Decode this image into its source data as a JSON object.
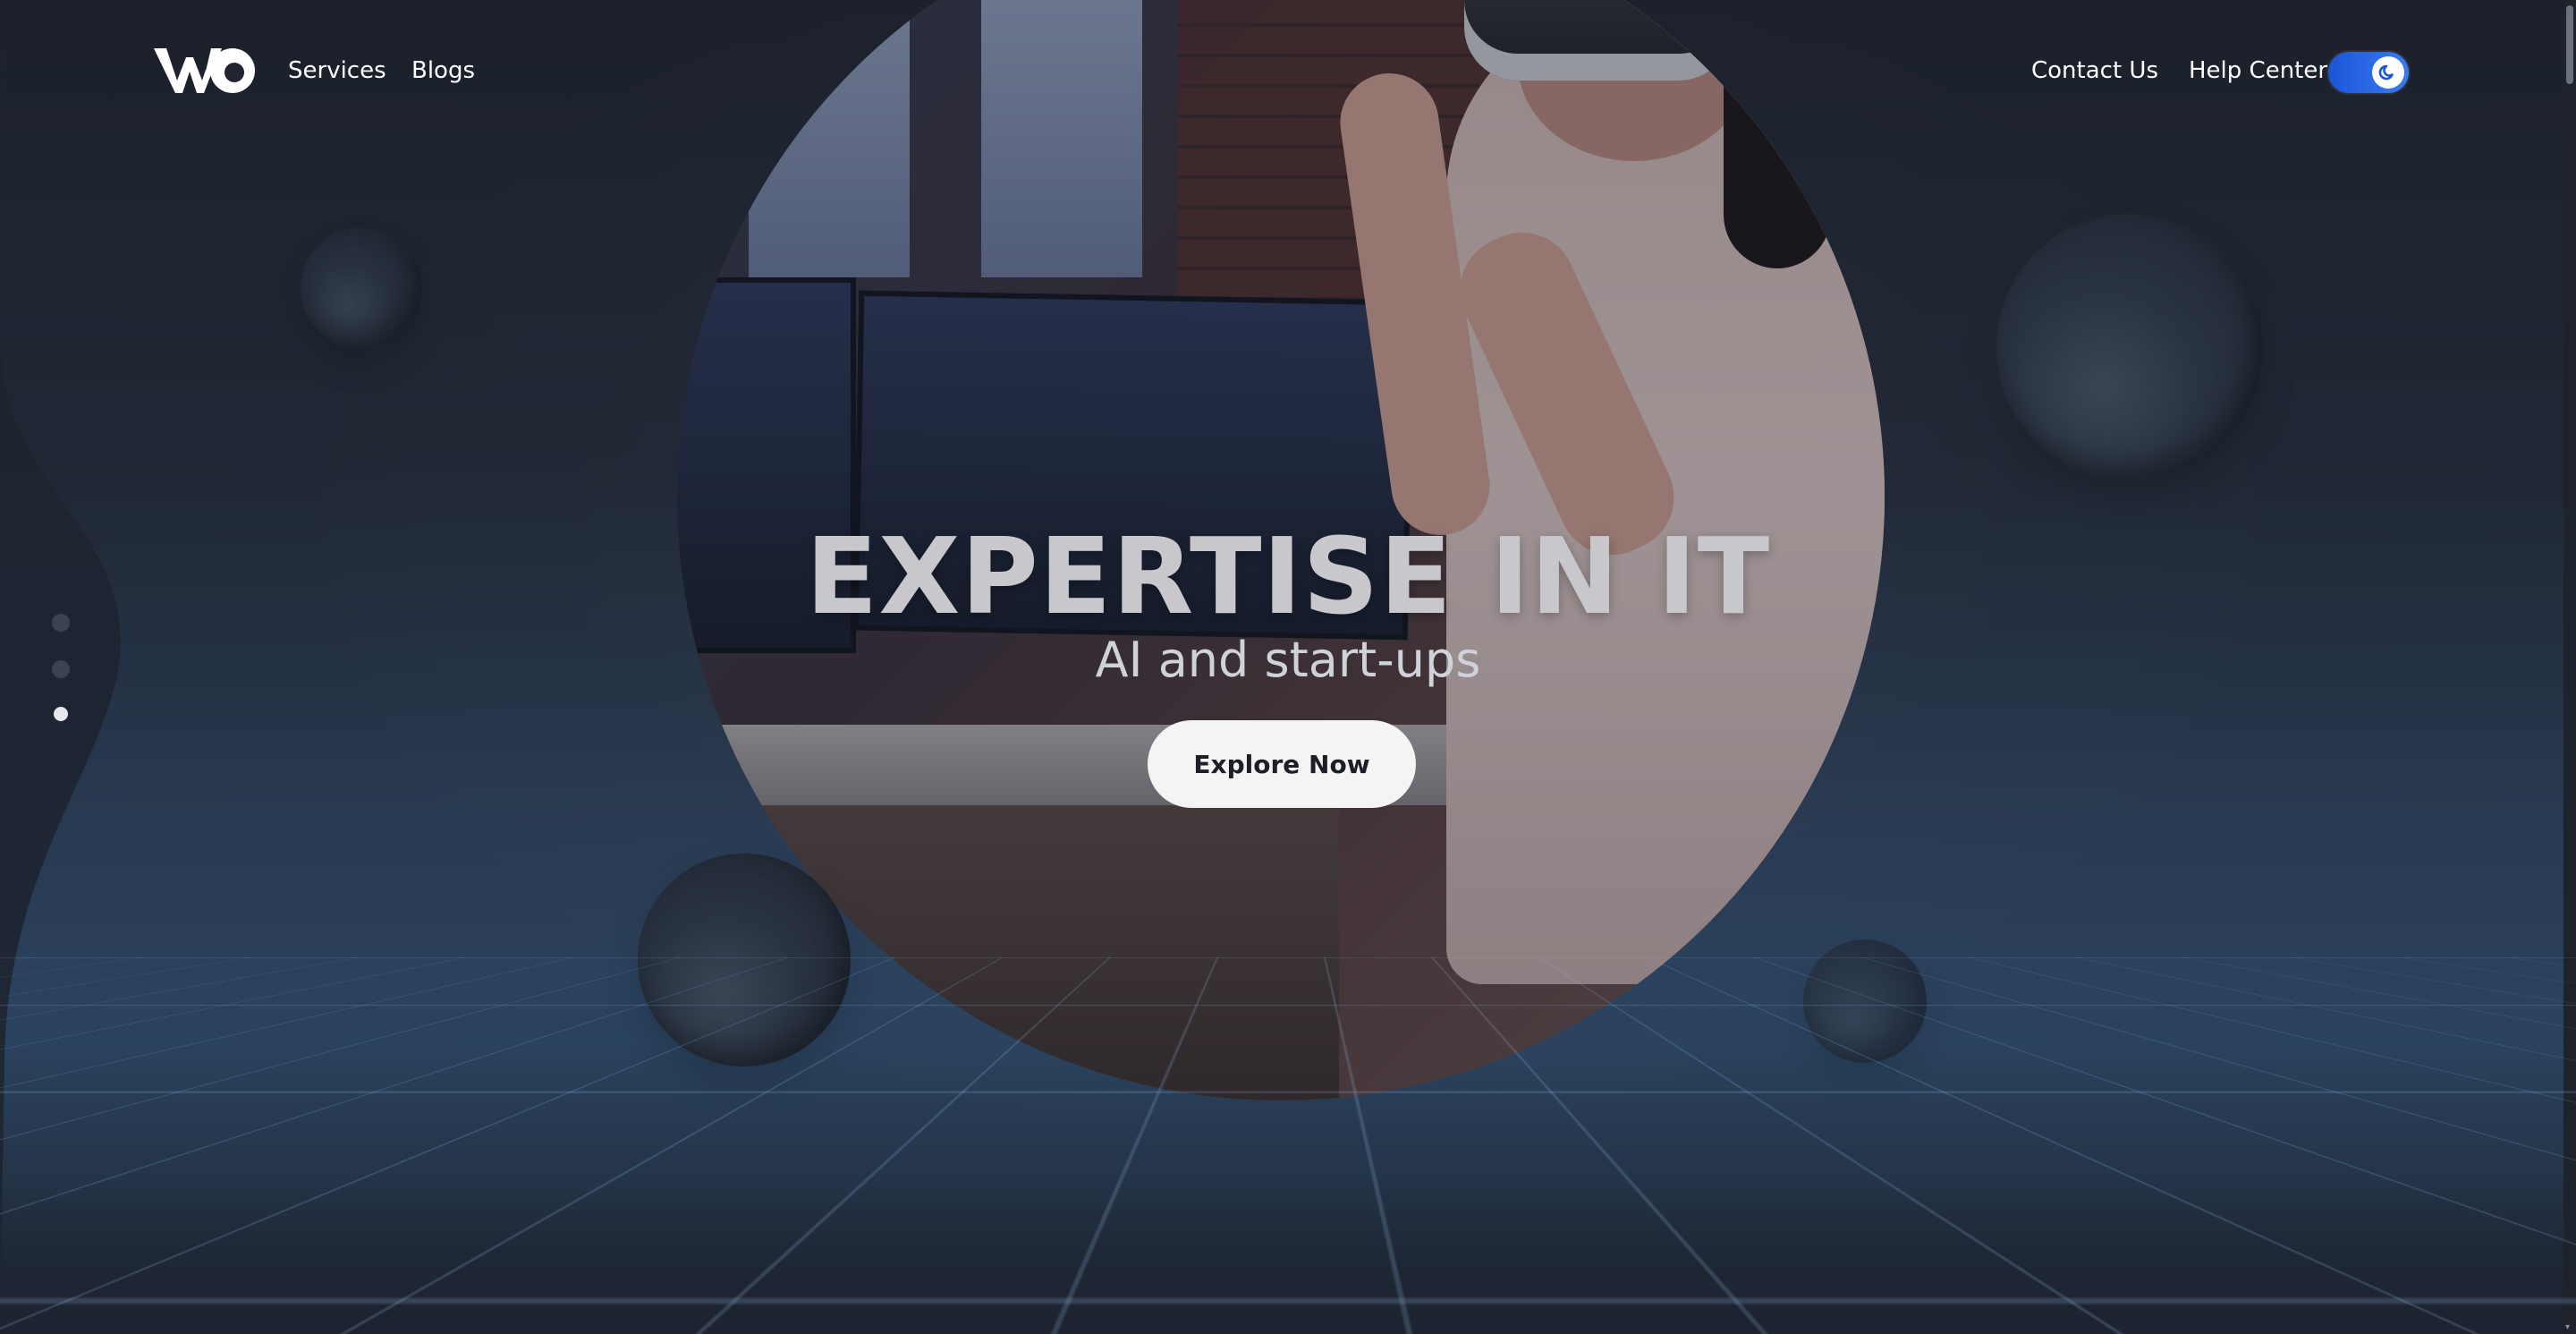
{
  "nav": {
    "links_left": [
      "Services",
      "Blogs"
    ],
    "links_right": [
      "Contact Us",
      "Help Center"
    ],
    "theme_toggle": {
      "state": "dark",
      "icon": "moon-icon"
    }
  },
  "hero": {
    "title": "EXPERTISE IN IT",
    "subtitle": "AI and start-ups",
    "cta_label": "Explore Now"
  },
  "slider": {
    "dot_count": 3,
    "active_index": 2
  },
  "colors": {
    "toggle_accent": "#1a56d8",
    "cta_bg": "#f4f4f4",
    "title_color": "#c8c8cc"
  }
}
